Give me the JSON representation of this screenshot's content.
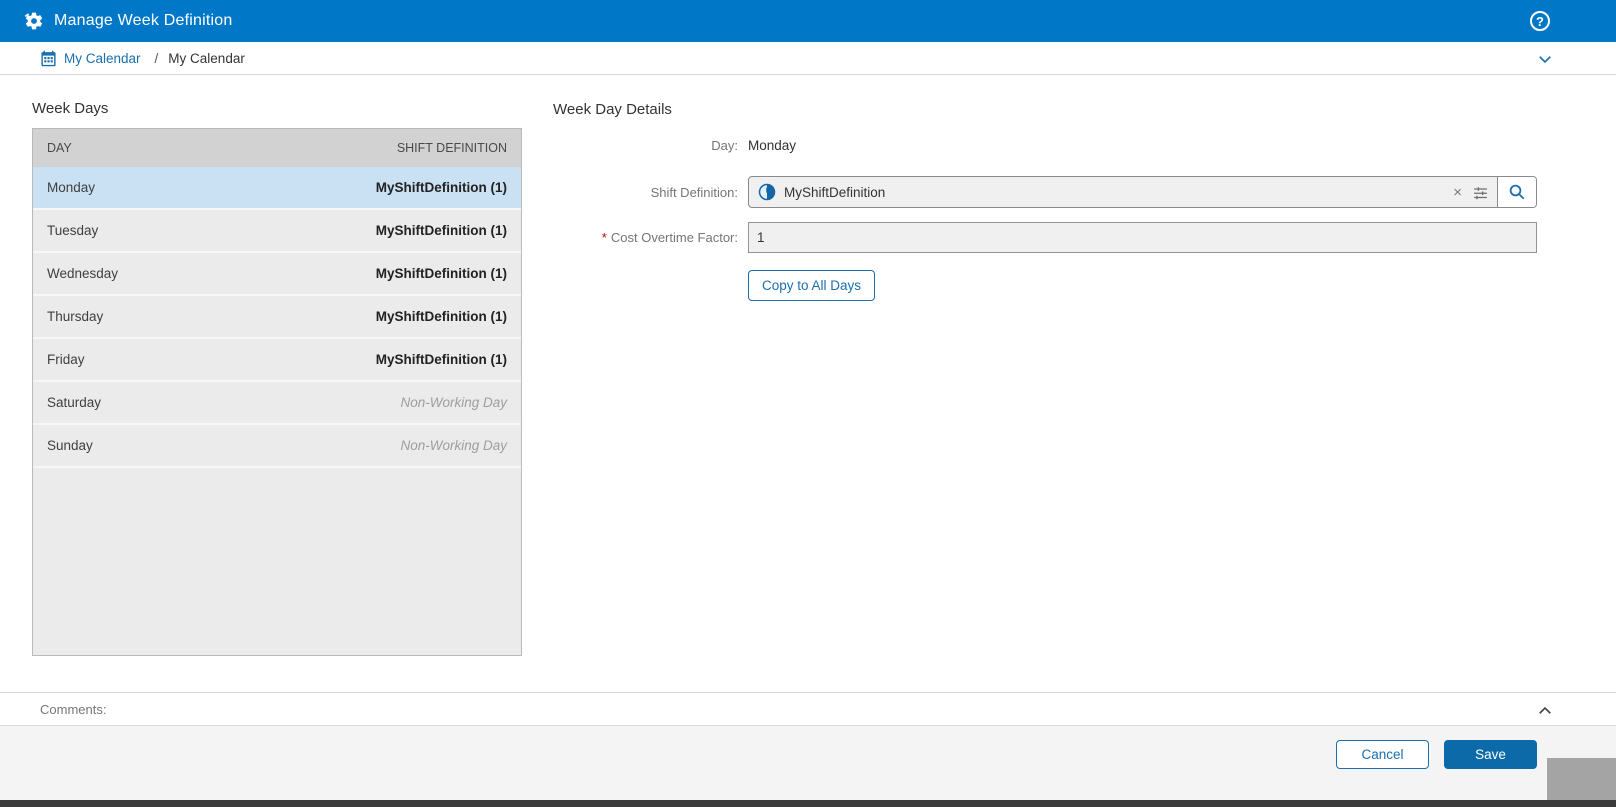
{
  "header": {
    "title": "Manage Week Definition",
    "app_icon": "gear-icon",
    "help_icon": "question-circle-icon",
    "help_glyph": "?"
  },
  "breadcrumb": {
    "icon": "calendar-icon",
    "link": "My Calendar",
    "separator": "/",
    "current": "My Calendar",
    "collapse_icon": "chevron-down-icon"
  },
  "left_panel": {
    "heading": "Week Days",
    "columns": {
      "day": "DAY",
      "shift": "SHIFT DEFINITION"
    },
    "rows": [
      {
        "day": "Monday",
        "shift": "MyShiftDefinition (1)",
        "type": "shift",
        "selected": true
      },
      {
        "day": "Tuesday",
        "shift": "MyShiftDefinition (1)",
        "type": "shift",
        "selected": false
      },
      {
        "day": "Wednesday",
        "shift": "MyShiftDefinition (1)",
        "type": "shift",
        "selected": false
      },
      {
        "day": "Thursday",
        "shift": "MyShiftDefinition (1)",
        "type": "shift",
        "selected": false
      },
      {
        "day": "Friday",
        "shift": "MyShiftDefinition (1)",
        "type": "shift",
        "selected": false
      },
      {
        "day": "Saturday",
        "shift": "Non-Working Day",
        "type": "non_working",
        "selected": false
      },
      {
        "day": "Sunday",
        "shift": "Non-Working Day",
        "type": "non_working",
        "selected": false
      }
    ]
  },
  "right_panel": {
    "heading": "Week Day Details",
    "day": {
      "label": "Day:",
      "value": "Monday"
    },
    "shift_definition": {
      "label": "Shift Definition:",
      "value": "MyShiftDefinition",
      "chip_icon": "shift-clock-icon",
      "clear_glyph": "×",
      "clear_icon": "clear-icon",
      "tune_icon": "tune-icon",
      "search_icon": "search-icon"
    },
    "cost_overtime_factor": {
      "required_marker": "*",
      "label": "Cost Overtime Factor:",
      "value": "1"
    },
    "copy_button": "Copy to All Days"
  },
  "footer": {
    "comments_label": "Comments:",
    "comments_collapse_icon": "chevron-up-icon",
    "cancel": "Cancel",
    "save": "Save"
  },
  "colors": {
    "header_bg": "#0077C7",
    "link_blue": "#1B6FAE",
    "selected_row": "#C9E1F3",
    "table_header_bg": "#D2D2D2",
    "row_bg": "#EBEBEB",
    "save_bg": "#0C6AA8",
    "required_red": "#C00000",
    "footer_bg": "#F4F4F4"
  }
}
